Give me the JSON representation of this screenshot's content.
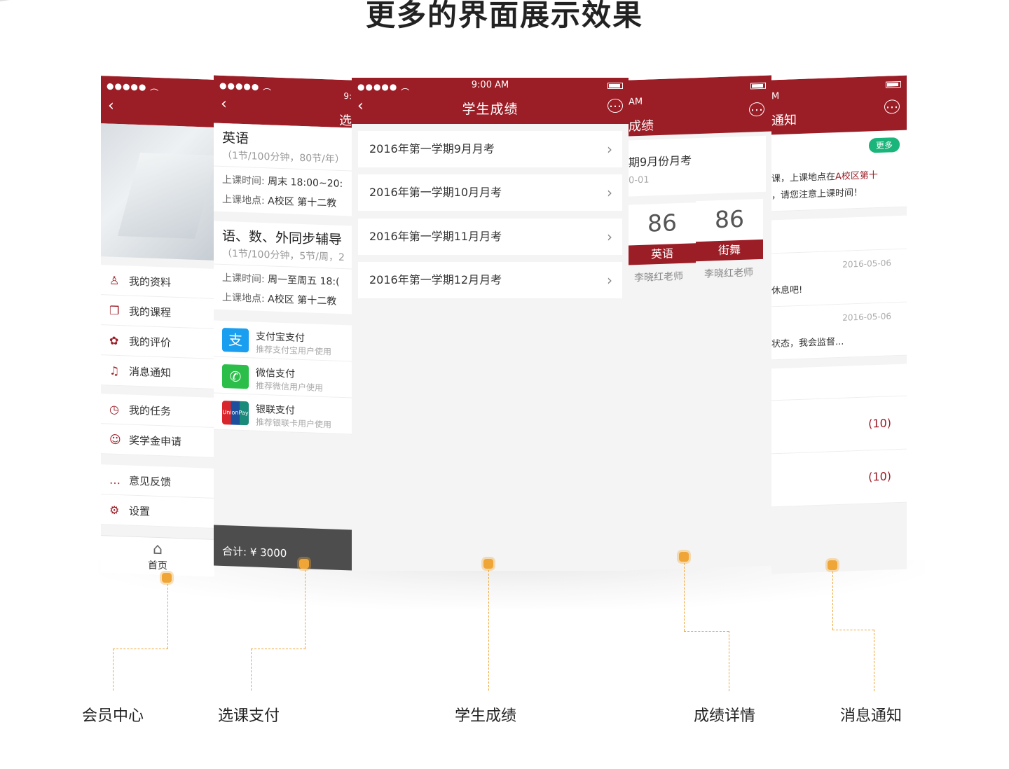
{
  "page": {
    "title": "更多的界面展示效果"
  },
  "colors": {
    "brand_red": "#9b1d26",
    "accent_orange": "#f0a637",
    "wechat_green": "#19b57a",
    "alipay_blue": "#1a9ff0"
  },
  "phone_member": {
    "menu_group_1": [
      "我的资料",
      "我的课程",
      "我的评价",
      "消息通知"
    ],
    "menu_group_2": [
      "我的任务",
      "奖学金申请"
    ],
    "menu_group_3": [
      "意见反馈",
      "设置"
    ],
    "tabbar_label": "首页"
  },
  "phone_course_pay": {
    "header_time": "9:",
    "header_title_fragment": "选",
    "courses": [
      {
        "name": "英语",
        "sub": "（1节/100分钟，80节/年）",
        "time_label": "上课时间:",
        "time_value": "周末 18:00~20:",
        "place_label": "上课地点:",
        "place_value": "A校区 第十二教"
      },
      {
        "name": "语、数、外同步辅导",
        "sub": "（1节/100分钟，5节/周，2",
        "time_label": "上课时间:",
        "time_value": "周一至周五 18:(",
        "place_label": "上课地点:",
        "place_value": "A校区 第十二教"
      }
    ],
    "payments": [
      {
        "title": "支付宝支付",
        "desc": "推荐支付宝用户使用",
        "logo_glyph": "支"
      },
      {
        "title": "微信支付",
        "desc": "推荐微信用户使用",
        "logo_glyph": "✆"
      },
      {
        "title": "银联支付",
        "desc": "推荐银联卡用户使用",
        "logo_glyph": "UnionPay"
      }
    ],
    "total": "合计: ¥ 3000"
  },
  "phone_scores": {
    "time": "9:00 AM",
    "title": "学生成绩",
    "exams": [
      "2016年第一学期9月月考",
      "2016年第一学期10月月考",
      "2016年第一学期11月月考",
      "2016年第一学期12月月考"
    ]
  },
  "phone_score_detail": {
    "header_time": "AM",
    "header_title_fragment": "成绩",
    "exam_title": "期9月份月考",
    "exam_date": "0-01",
    "cards": [
      {
        "score": "86",
        "subject": "英语",
        "teacher": "李晓红老师"
      },
      {
        "score": "86",
        "subject": "街舞",
        "teacher": "李晓红老师"
      }
    ]
  },
  "phone_notifications": {
    "header_time": "M",
    "header_title_fragment": "通知",
    "more_label": "更多",
    "notice_line_1_pre": "课，上课地点在",
    "notice_line_1_hl": "A校区第十",
    "notice_line_2": "，请您注意上课时间！",
    "messages": [
      {
        "date": "2016-05-06",
        "text": "休息吧!"
      },
      {
        "date": "2016-05-06",
        "text": "状态，我会监督..."
      }
    ],
    "counts": [
      "(10)",
      "(10)"
    ]
  },
  "labels": [
    "会员中心",
    "选课支付",
    "学生成绩",
    "成绩详情",
    "消息通知"
  ]
}
